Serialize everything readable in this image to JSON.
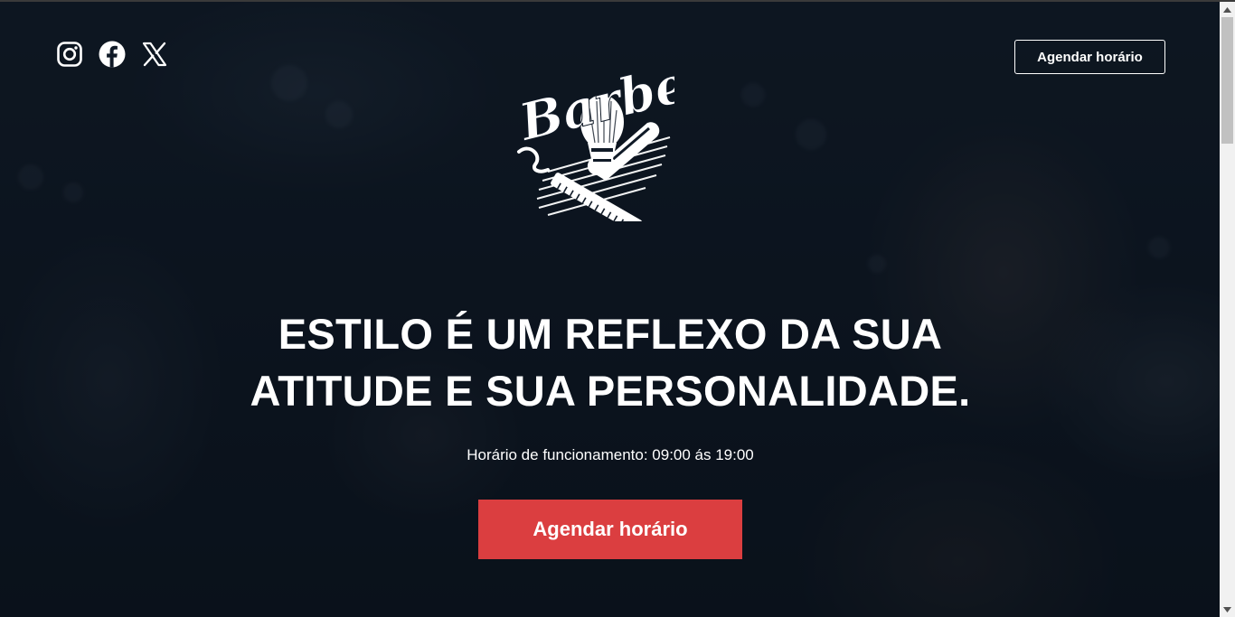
{
  "header": {
    "socials": [
      {
        "name": "instagram-icon"
      },
      {
        "name": "facebook-icon"
      },
      {
        "name": "x-twitter-icon"
      }
    ],
    "logo_text": "Barber",
    "cta_label": "Agendar horário"
  },
  "hero": {
    "headline_line1": "ESTILO É UM REFLEXO DA SUA",
    "headline_line2": "ATITUDE E SUA PERSONALIDADE.",
    "hours": "Horário de funcionamento: 09:00 ás 19:00",
    "cta_label": "Agendar horário"
  },
  "colors": {
    "accent": "#db3e40",
    "background": "#0b1420",
    "text": "#ffffff"
  }
}
